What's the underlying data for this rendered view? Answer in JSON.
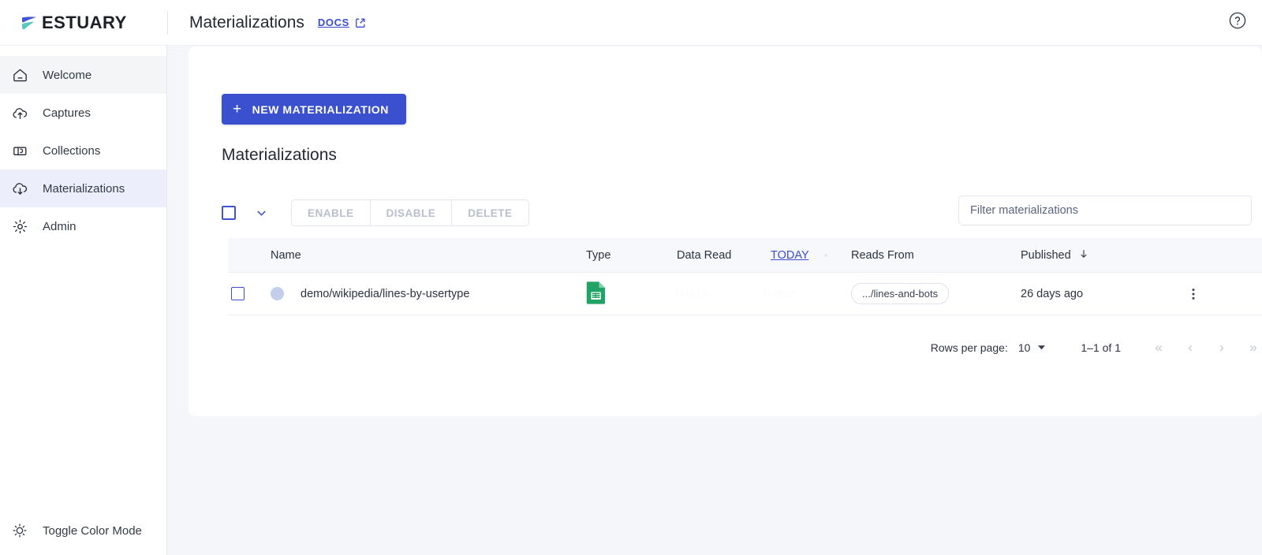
{
  "brand": {
    "name": "ESTUARY",
    "logo_icon": "estuary-wave-logo",
    "logo_colors": {
      "top": "#4154d3",
      "bottom": "#58c8c0"
    }
  },
  "header": {
    "title": "Materializations",
    "docs_label": "DOCS",
    "docs_external_icon": "external-link-icon",
    "help_icon": "help-circle-icon"
  },
  "sidebar": {
    "items": [
      {
        "label": "Welcome",
        "icon": "home-icon",
        "active": false
      },
      {
        "label": "Captures",
        "icon": "cloud-upload-icon",
        "active": false
      },
      {
        "label": "Collections",
        "icon": "collections-icon",
        "active": false
      },
      {
        "label": "Materializations",
        "icon": "cloud-download-icon",
        "active": true
      },
      {
        "label": "Admin",
        "icon": "gear-icon",
        "active": false
      }
    ],
    "color_mode": {
      "label": "Toggle Color Mode",
      "icon": "sun-icon"
    }
  },
  "main": {
    "new_button": {
      "label": "NEW MATERIALIZATION",
      "icon": "plus-icon",
      "color": "#3a50ce"
    },
    "section_title": "Materializations",
    "toolbar": {
      "select_all_checkbox": false,
      "select_caret_icon": "chevron-down-icon",
      "actions": [
        {
          "label": "ENABLE",
          "disabled": true
        },
        {
          "label": "DISABLE",
          "disabled": true
        },
        {
          "label": "DELETE",
          "disabled": true
        }
      ]
    },
    "filter": {
      "placeholder": "Filter materializations",
      "value": ""
    },
    "table": {
      "columns": [
        {
          "key": "name",
          "label": "Name"
        },
        {
          "key": "type",
          "label": "Type"
        },
        {
          "key": "read",
          "label": "Data Read"
        },
        {
          "key": "today",
          "label": "TODAY",
          "is_link": true
        },
        {
          "key": "reads",
          "label": "Reads From"
        },
        {
          "key": "pub",
          "label": "Published",
          "sort_icon": "arrow-down-icon"
        }
      ],
      "rows": [
        {
          "selected": false,
          "status": "pending",
          "name": "demo/wikipedia/lines-by-usertype",
          "type_icon": "google-sheets-icon",
          "data_read_bytes": "0.00 B",
          "data_read_docs": "0 docs",
          "reads_from": ".../lines-and-bots",
          "published": "26 days ago",
          "menu_icon": "kebab-menu-icon"
        }
      ]
    },
    "pagination": {
      "rows_per_page_label": "Rows per page:",
      "rows_per_page_value": "10",
      "range_label": "1–1 of 1",
      "first_icon": "«",
      "prev_icon": "‹",
      "next_icon": "›",
      "last_icon": "»"
    }
  }
}
